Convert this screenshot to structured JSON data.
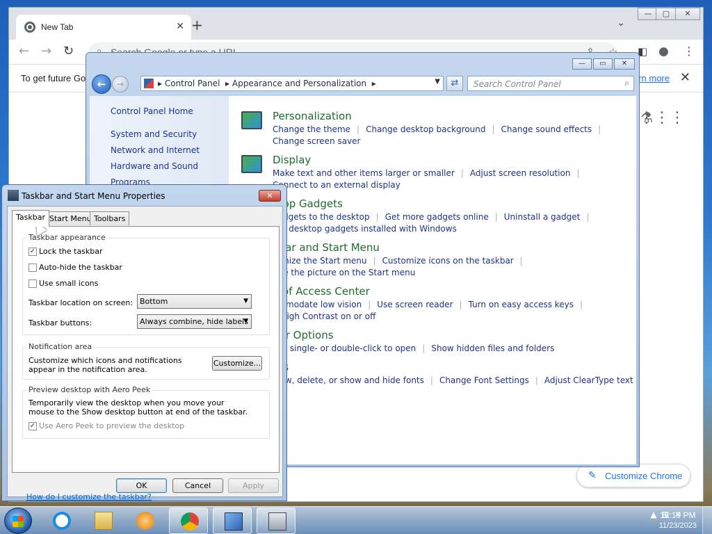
{
  "chrome": {
    "tab_title": "New Tab",
    "omnibox_placeholder": "Search Google or type a URL",
    "infobar_text": "To get future Go",
    "learn_more": "rn more",
    "customize_label": "Customize Chrome"
  },
  "control_panel": {
    "breadcrumb_1": "Control Panel",
    "breadcrumb_2": "Appearance and Personalization",
    "search_placeholder": "Search Control Panel",
    "left_nav": [
      "Control Panel Home",
      "System and Security",
      "Network and Internet",
      "Hardware and Sound",
      "Programs"
    ],
    "categories": [
      {
        "title": "Personalization",
        "links": [
          "Change the theme",
          "Change desktop background",
          "Change sound effects",
          "Change screen saver"
        ]
      },
      {
        "title": "Display",
        "links": [
          "Make text and other items larger or smaller",
          "Adjust screen resolution",
          "Connect to an external display"
        ]
      },
      {
        "title": "ktop Gadgets",
        "links": [
          "gadgets to the desktop",
          "Get more gadgets online",
          "Uninstall a gadget",
          "ore desktop gadgets installed with Windows"
        ]
      },
      {
        "title": "kbar and Start Menu",
        "links": [
          "tomize the Start menu",
          "Customize icons on the taskbar",
          "nge the picture on the Start menu"
        ]
      },
      {
        "title": "e of Access Center",
        "links": [
          "ommodate low vision",
          "Use screen reader",
          "Turn on easy access keys",
          "n High Contrast on or off"
        ]
      },
      {
        "title": "der Options",
        "links": [
          "cify single- or double-click to open",
          "Show hidden files and folders"
        ]
      },
      {
        "title": "nts",
        "links": [
          "view, delete, or show and hide fonts",
          "Change Font Settings",
          "Adjust ClearType text"
        ]
      }
    ]
  },
  "dialog": {
    "title": "Taskbar and Start Menu Properties",
    "tabs": [
      "Taskbar",
      "Start Menu",
      "Toolbars"
    ],
    "appearance_group": "Taskbar appearance",
    "lock_taskbar": "Lock the taskbar",
    "lock_taskbar_checked": true,
    "auto_hide": "Auto-hide the taskbar",
    "auto_hide_checked": false,
    "small_icons": "Use small icons",
    "small_icons_checked": false,
    "location_label": "Taskbar location on screen:",
    "location_value": "Bottom",
    "buttons_label": "Taskbar buttons:",
    "buttons_value": "Always combine, hide labels",
    "notification_group": "Notification area",
    "notification_desc": "Customize which icons and notifications appear in the notification area.",
    "customize_button": "Customize...",
    "peek_group": "Preview desktop with Aero Peek",
    "peek_desc": "Temporarily view the desktop when you move your mouse to the Show desktop button at end of the taskbar.",
    "peek_checkbox": "Use Aero Peek to preview the desktop",
    "peek_checked": true,
    "help_link": "How do I customize the taskbar?",
    "ok": "OK",
    "cancel": "Cancel",
    "apply": "Apply"
  },
  "taskbar": {
    "time": "12:19 PM",
    "date": "11/23/2023",
    "pinned_icons": [
      "internet-explorer-icon",
      "file-explorer-icon",
      "media-player-icon",
      "chrome-icon",
      "control-panel-icon",
      "taskbar-properties-icon"
    ]
  }
}
